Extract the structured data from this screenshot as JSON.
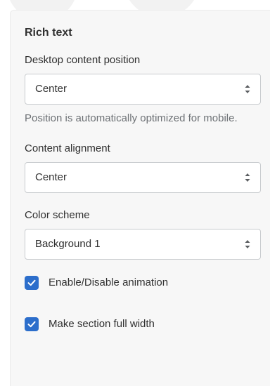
{
  "panel": {
    "title": "Rich text"
  },
  "fields": {
    "desktop_position": {
      "label": "Desktop content position",
      "value": "Center",
      "help": "Position is automatically optimized for mobile."
    },
    "content_alignment": {
      "label": "Content alignment",
      "value": "Center"
    },
    "color_scheme": {
      "label": "Color scheme",
      "value": "Background 1"
    }
  },
  "checkboxes": {
    "animation": {
      "label": "Enable/Disable animation",
      "checked": true
    },
    "full_width": {
      "label": "Make section full width",
      "checked": true
    }
  },
  "colors": {
    "accent": "#2c6ecb",
    "panel_bg": "#f7f7f7",
    "border": "#c9cccf",
    "help_text": "#6d7175"
  },
  "icons": {
    "select_chevron": "chevron-up-down-icon",
    "check": "checkmark-icon"
  }
}
